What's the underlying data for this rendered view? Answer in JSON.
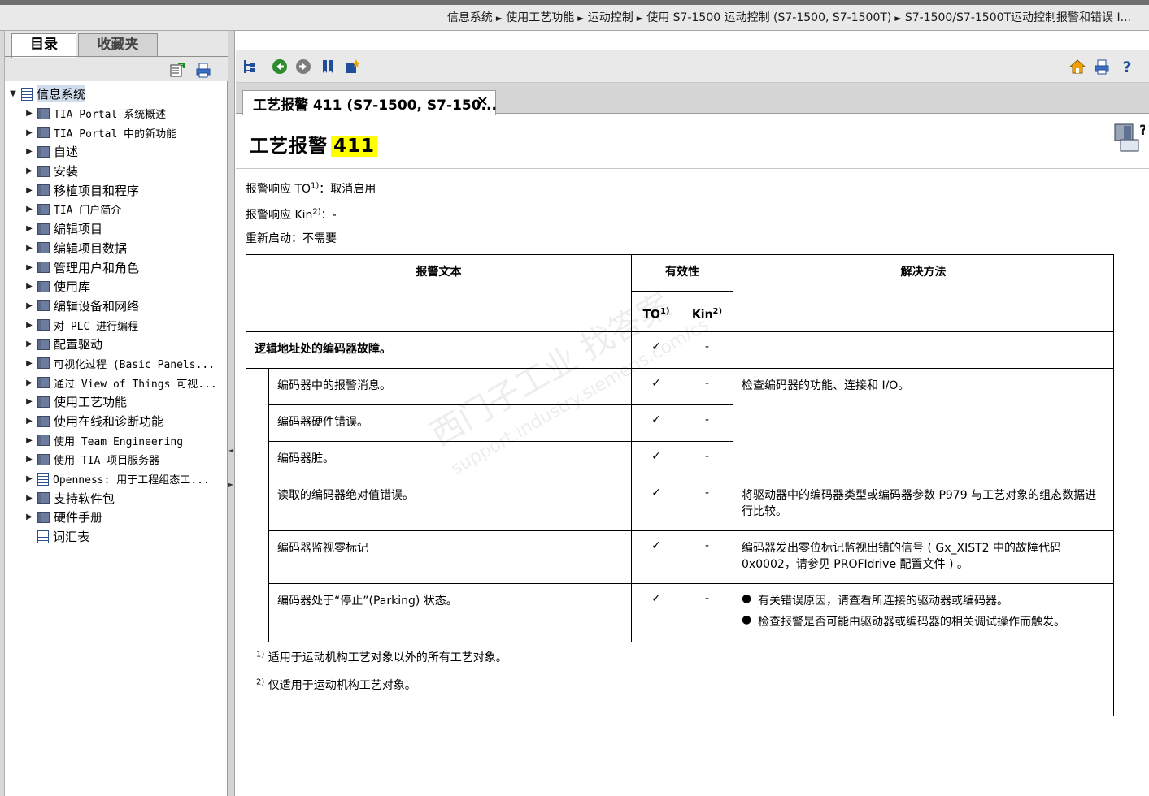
{
  "breadcrumb": {
    "items": [
      "信息系统",
      "使用工艺功能",
      "运动控制",
      "使用 S7-1500 运动控制 (S7-1500, S7-1500T)",
      "S7-1500/S7-1500T运动控制报警和错误 I..."
    ],
    "separator": "►"
  },
  "left_tabs": {
    "toc": "目录",
    "favorites": "收藏夹"
  },
  "tree": {
    "root": {
      "label": "信息系统"
    },
    "items": [
      {
        "label": "TIA Portal 系统概述",
        "icon": "book-icon"
      },
      {
        "label": "TIA Portal 中的新功能",
        "icon": "book-icon"
      },
      {
        "label": "自述",
        "icon": "book-icon"
      },
      {
        "label": "安装",
        "icon": "book-icon"
      },
      {
        "label": "移植项目和程序",
        "icon": "book-icon"
      },
      {
        "label": "TIA 门户简介",
        "icon": "book-icon"
      },
      {
        "label": "编辑项目",
        "icon": "book-icon"
      },
      {
        "label": "编辑项目数据",
        "icon": "book-icon"
      },
      {
        "label": "管理用户和角色",
        "icon": "book-icon"
      },
      {
        "label": "使用库",
        "icon": "book-icon"
      },
      {
        "label": "编辑设备和网络",
        "icon": "book-icon"
      },
      {
        "label": "对 PLC 进行编程",
        "icon": "book-icon"
      },
      {
        "label": "配置驱动",
        "icon": "book-icon"
      },
      {
        "label": "可视化过程 (Basic Panels...",
        "icon": "book-icon"
      },
      {
        "label": "通过 View of Things 可视...",
        "icon": "book-icon"
      },
      {
        "label": "使用工艺功能",
        "icon": "book-icon"
      },
      {
        "label": "使用在线和诊断功能",
        "icon": "book-icon"
      },
      {
        "label": "使用 Team Engineering",
        "icon": "book-icon"
      },
      {
        "label": "使用 TIA 项目服务器",
        "icon": "book-icon"
      },
      {
        "label": "Openness: 用于工程组态工...",
        "icon": "doc-icon"
      },
      {
        "label": "支持软件包",
        "icon": "book-icon"
      },
      {
        "label": "硬件手册",
        "icon": "book-icon"
      },
      {
        "label": "词汇表",
        "icon": "glossary-icon"
      }
    ]
  },
  "doc_tab": {
    "title": "工艺报警 411 (S7-1500, S7-150...",
    "close": "×"
  },
  "page": {
    "title_prefix": "工艺报警",
    "title_number": "411",
    "response_to_label": "报警响应 TO",
    "response_to_sup": "1)",
    "response_to_value": "：取消启用",
    "response_kin_label": "报警响应 Kin",
    "response_kin_sup": "2)",
    "response_kin_value": "：-",
    "restart": "重新启动：不需要"
  },
  "table": {
    "headers": {
      "alarm_text": "报警文本",
      "validity": "有效性",
      "to": "TO",
      "to_sup": "1)",
      "kin": "Kin",
      "kin_sup": "2)",
      "solution": "解决方法"
    },
    "main_row": {
      "text": "逻辑地址处的编码器故障。",
      "to": "✓",
      "kin": "-"
    },
    "rows": [
      {
        "text": "编码器中的报警消息。",
        "to": "✓",
        "kin": "-"
      },
      {
        "text": "编码器硬件错误。",
        "to": "✓",
        "kin": "-"
      },
      {
        "text": "编码器脏。",
        "to": "✓",
        "kin": "-"
      },
      {
        "text": "读取的编码器绝对值错误。",
        "to": "✓",
        "kin": "-"
      },
      {
        "text": "编码器监视零标记",
        "to": "✓",
        "kin": "-"
      },
      {
        "text": "编码器处于“停止”(Parking) 状态。",
        "to": "✓",
        "kin": "-"
      }
    ],
    "solutions": {
      "encoder_check": "检查编码器的功能、连接和 I/O。",
      "absolute_value": "将驱动器中的编码器类型或编码器参数 P979 与工艺对象的组态数据进行比较。",
      "zero_mark": "编码器发出零位标记监视出错的信号 ( Gx_XIST2 中的故障代码 0x0002，请参见 PROFIdrive 配置文件 ) 。",
      "parking": [
        "有关错误原因，请查看所连接的驱动器或编码器。",
        "检查报警是否可能由驱动器或编码器的相关调试操作而触发。"
      ]
    },
    "notes": [
      {
        "sup": "1)",
        "text": "适用于运动机构工艺对象以外的所有工艺对象。"
      },
      {
        "sup": "2)",
        "text": "仅适用于运动机构工艺对象。"
      }
    ]
  },
  "watermark": {
    "text_cn": "西门子工业  找答案",
    "text_url": "support.industry.siemens.com/cs"
  },
  "colors": {
    "highlight": "#ffff00",
    "toolbar_bg": "#e9e9e9",
    "selection": "#cfdcec"
  }
}
